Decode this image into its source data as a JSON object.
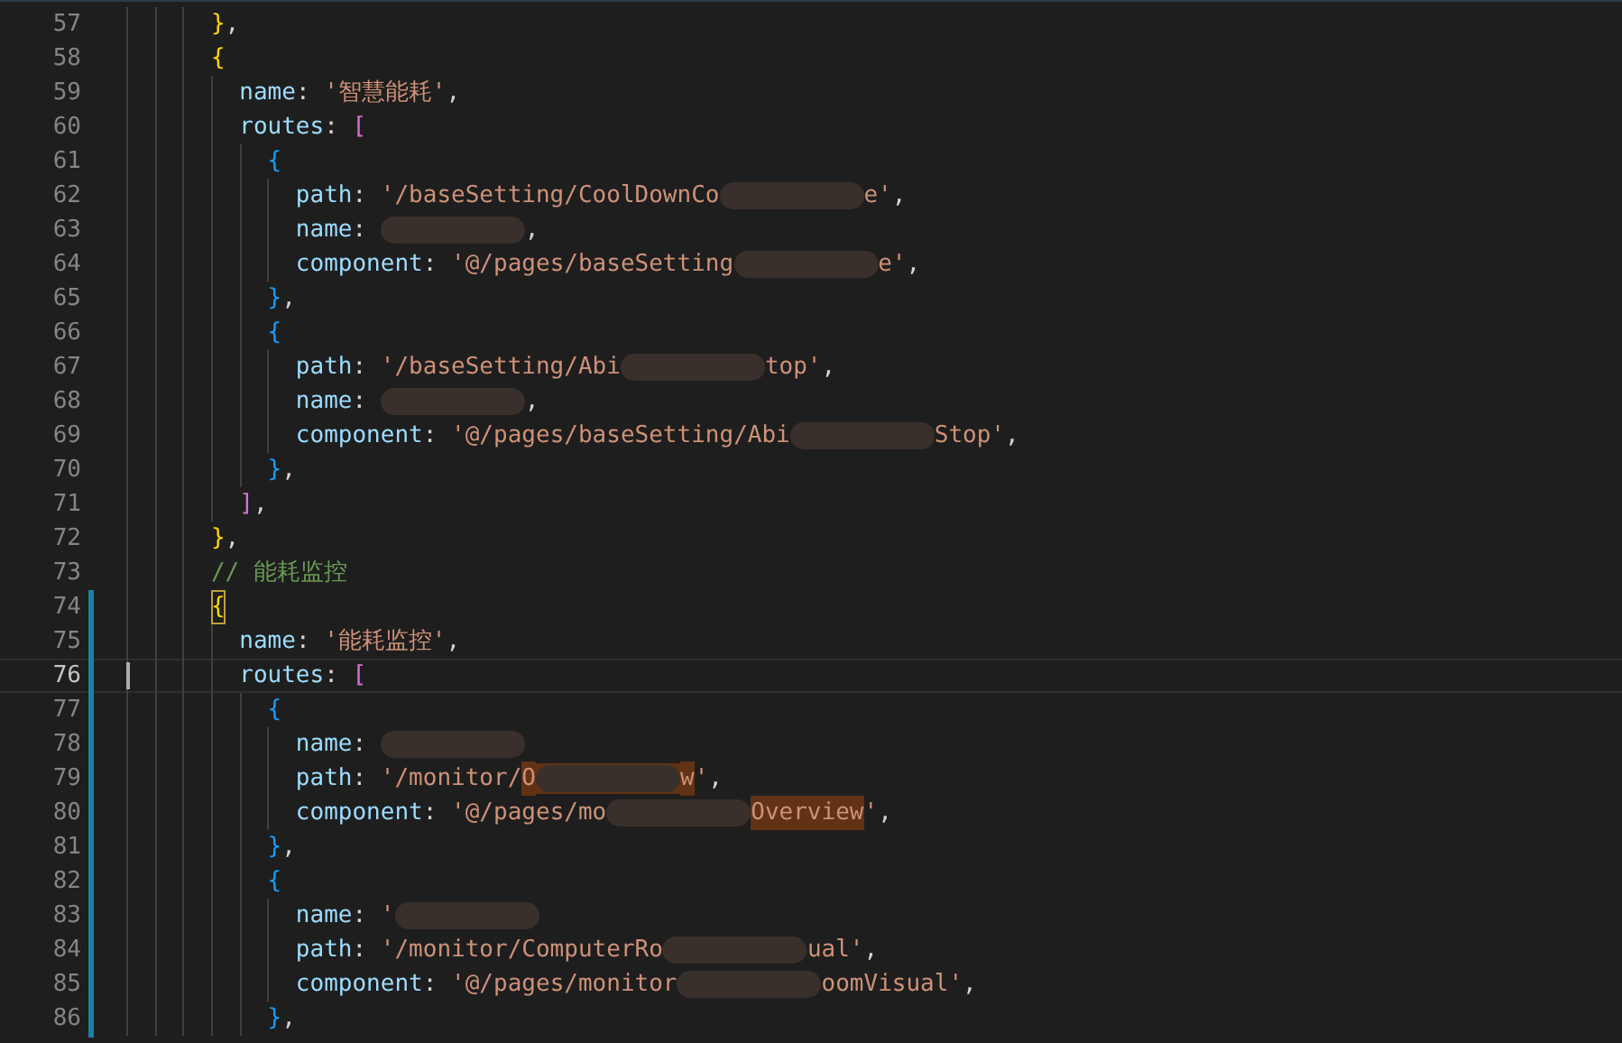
{
  "editor": {
    "lines": [
      {
        "number": "57",
        "modified": false,
        "current": false,
        "tokens": [
          {
            "kind": "bracket",
            "color": "#ffd700",
            "text": "      }"
          },
          {
            "kind": "punct",
            "text": ","
          }
        ]
      },
      {
        "number": "58",
        "modified": false,
        "current": false,
        "tokens": [
          {
            "kind": "bracket",
            "color": "#ffd700",
            "text": "      {"
          }
        ]
      },
      {
        "number": "59",
        "modified": false,
        "current": false,
        "tokens": [
          {
            "kind": "key",
            "text": "        name"
          },
          {
            "kind": "punct",
            "text": ": "
          },
          {
            "kind": "string",
            "text": "'智慧能耗'"
          },
          {
            "kind": "punct",
            "text": ","
          }
        ]
      },
      {
        "number": "60",
        "modified": false,
        "current": false,
        "tokens": [
          {
            "kind": "key",
            "text": "        routes"
          },
          {
            "kind": "punct",
            "text": ": "
          },
          {
            "kind": "bracket",
            "color": "#da70d6",
            "text": "["
          }
        ]
      },
      {
        "number": "61",
        "modified": false,
        "current": false,
        "tokens": [
          {
            "kind": "bracket",
            "color": "#179fff",
            "text": "          {"
          }
        ]
      },
      {
        "number": "62",
        "modified": false,
        "current": false,
        "tokens": [
          {
            "kind": "key",
            "text": "            path"
          },
          {
            "kind": "punct",
            "text": ": "
          },
          {
            "kind": "string",
            "text": "'/baseSetting/CoolDownCo"
          },
          {
            "kind": "blur"
          },
          {
            "kind": "string",
            "text": "e'"
          },
          {
            "kind": "punct",
            "text": ","
          }
        ]
      },
      {
        "number": "63",
        "modified": false,
        "current": false,
        "tokens": [
          {
            "kind": "key",
            "text": "            name"
          },
          {
            "kind": "punct",
            "text": ": "
          },
          {
            "kind": "blur"
          },
          {
            "kind": "punct",
            "text": ","
          }
        ]
      },
      {
        "number": "64",
        "modified": false,
        "current": false,
        "tokens": [
          {
            "kind": "key",
            "text": "            component"
          },
          {
            "kind": "punct",
            "text": ": "
          },
          {
            "kind": "string",
            "text": "'@/pages/baseSetting"
          },
          {
            "kind": "blur"
          },
          {
            "kind": "string",
            "text": "e'"
          },
          {
            "kind": "punct",
            "text": ","
          }
        ]
      },
      {
        "number": "65",
        "modified": false,
        "current": false,
        "tokens": [
          {
            "kind": "bracket",
            "color": "#179fff",
            "text": "          }"
          },
          {
            "kind": "punct",
            "text": ","
          }
        ]
      },
      {
        "number": "66",
        "modified": false,
        "current": false,
        "tokens": [
          {
            "kind": "bracket",
            "color": "#179fff",
            "text": "          {"
          }
        ]
      },
      {
        "number": "67",
        "modified": false,
        "current": false,
        "tokens": [
          {
            "kind": "key",
            "text": "            path"
          },
          {
            "kind": "punct",
            "text": ": "
          },
          {
            "kind": "string",
            "text": "'/baseSetting/Abi"
          },
          {
            "kind": "blur"
          },
          {
            "kind": "string",
            "text": "top'"
          },
          {
            "kind": "punct",
            "text": ","
          }
        ]
      },
      {
        "number": "68",
        "modified": false,
        "current": false,
        "tokens": [
          {
            "kind": "key",
            "text": "            name"
          },
          {
            "kind": "punct",
            "text": ": "
          },
          {
            "kind": "blur"
          },
          {
            "kind": "punct",
            "text": ","
          }
        ]
      },
      {
        "number": "69",
        "modified": false,
        "current": false,
        "tokens": [
          {
            "kind": "key",
            "text": "            component"
          },
          {
            "kind": "punct",
            "text": ": "
          },
          {
            "kind": "string",
            "text": "'@/pages/baseSetting/Abi"
          },
          {
            "kind": "blur"
          },
          {
            "kind": "string",
            "text": "Stop'"
          },
          {
            "kind": "punct",
            "text": ","
          }
        ]
      },
      {
        "number": "70",
        "modified": false,
        "current": false,
        "tokens": [
          {
            "kind": "bracket",
            "color": "#179fff",
            "text": "          }"
          },
          {
            "kind": "punct",
            "text": ","
          }
        ]
      },
      {
        "number": "71",
        "modified": false,
        "current": false,
        "tokens": [
          {
            "kind": "bracket",
            "color": "#da70d6",
            "text": "        ]"
          },
          {
            "kind": "punct",
            "text": ","
          }
        ]
      },
      {
        "number": "72",
        "modified": false,
        "current": false,
        "tokens": [
          {
            "kind": "bracket",
            "color": "#ffd700",
            "text": "      }"
          },
          {
            "kind": "punct",
            "text": ","
          }
        ]
      },
      {
        "number": "73",
        "modified": false,
        "current": false,
        "tokens": [
          {
            "kind": "comment",
            "text": "      // 能耗监控"
          }
        ]
      },
      {
        "number": "74",
        "modified": true,
        "current": false,
        "tokens": [
          {
            "kind": "bracket",
            "color": "#ffd700",
            "text": "      {",
            "matched": true
          }
        ]
      },
      {
        "number": "75",
        "modified": true,
        "current": false,
        "tokens": [
          {
            "kind": "key",
            "text": "        name"
          },
          {
            "kind": "punct",
            "text": ": "
          },
          {
            "kind": "string",
            "text": "'能耗监控'"
          },
          {
            "kind": "punct",
            "text": ","
          }
        ]
      },
      {
        "number": "76",
        "modified": true,
        "current": true,
        "tokens": [
          {
            "kind": "key",
            "text": "        routes"
          },
          {
            "kind": "punct",
            "text": ": "
          },
          {
            "kind": "bracket",
            "color": "#da70d6",
            "text": "["
          }
        ]
      },
      {
        "number": "77",
        "modified": true,
        "current": false,
        "tokens": [
          {
            "kind": "bracket",
            "color": "#179fff",
            "text": "          {"
          }
        ]
      },
      {
        "number": "78",
        "modified": true,
        "current": false,
        "tokens": [
          {
            "kind": "key",
            "text": "            name"
          },
          {
            "kind": "punct",
            "text": ": "
          },
          {
            "kind": "blur"
          }
        ]
      },
      {
        "number": "79",
        "modified": true,
        "current": false,
        "tokens": [
          {
            "kind": "key",
            "text": "            path"
          },
          {
            "kind": "punct",
            "text": ": "
          },
          {
            "kind": "string",
            "text": "'/monitor/"
          },
          {
            "kind": "string",
            "text": "O",
            "match": true
          },
          {
            "kind": "blur",
            "match": true
          },
          {
            "kind": "string",
            "text": "w",
            "match": true
          },
          {
            "kind": "string",
            "text": "'"
          },
          {
            "kind": "punct",
            "text": ","
          }
        ]
      },
      {
        "number": "80",
        "modified": true,
        "current": false,
        "tokens": [
          {
            "kind": "key",
            "text": "            component"
          },
          {
            "kind": "punct",
            "text": ": "
          },
          {
            "kind": "string",
            "text": "'@/pages/mo"
          },
          {
            "kind": "blur"
          },
          {
            "kind": "string",
            "text": "Overview",
            "match": true
          },
          {
            "kind": "string",
            "text": "'"
          },
          {
            "kind": "punct",
            "text": ","
          }
        ]
      },
      {
        "number": "81",
        "modified": true,
        "current": false,
        "tokens": [
          {
            "kind": "bracket",
            "color": "#179fff",
            "text": "          }"
          },
          {
            "kind": "punct",
            "text": ","
          }
        ]
      },
      {
        "number": "82",
        "modified": true,
        "current": false,
        "tokens": [
          {
            "kind": "bracket",
            "color": "#179fff",
            "text": "          {"
          }
        ]
      },
      {
        "number": "83",
        "modified": true,
        "current": false,
        "tokens": [
          {
            "kind": "key",
            "text": "            name"
          },
          {
            "kind": "punct",
            "text": ": "
          },
          {
            "kind": "string",
            "text": "'"
          },
          {
            "kind": "blur"
          }
        ]
      },
      {
        "number": "84",
        "modified": true,
        "current": false,
        "tokens": [
          {
            "kind": "key",
            "text": "            path"
          },
          {
            "kind": "punct",
            "text": ": "
          },
          {
            "kind": "string",
            "text": "'/monitor/ComputerRo"
          },
          {
            "kind": "blur"
          },
          {
            "kind": "string",
            "text": "ual'"
          },
          {
            "kind": "punct",
            "text": ","
          }
        ]
      },
      {
        "number": "85",
        "modified": true,
        "current": false,
        "tokens": [
          {
            "kind": "key",
            "text": "            component"
          },
          {
            "kind": "punct",
            "text": ": "
          },
          {
            "kind": "string",
            "text": "'@/pages/monitor"
          },
          {
            "kind": "blur"
          },
          {
            "kind": "string",
            "text": "oomVisual'"
          },
          {
            "kind": "punct",
            "text": ","
          }
        ]
      },
      {
        "number": "86",
        "modified": true,
        "current": false,
        "tokens": [
          {
            "kind": "bracket",
            "color": "#179fff",
            "text": "          }"
          },
          {
            "kind": "punct",
            "text": ","
          }
        ]
      }
    ]
  }
}
